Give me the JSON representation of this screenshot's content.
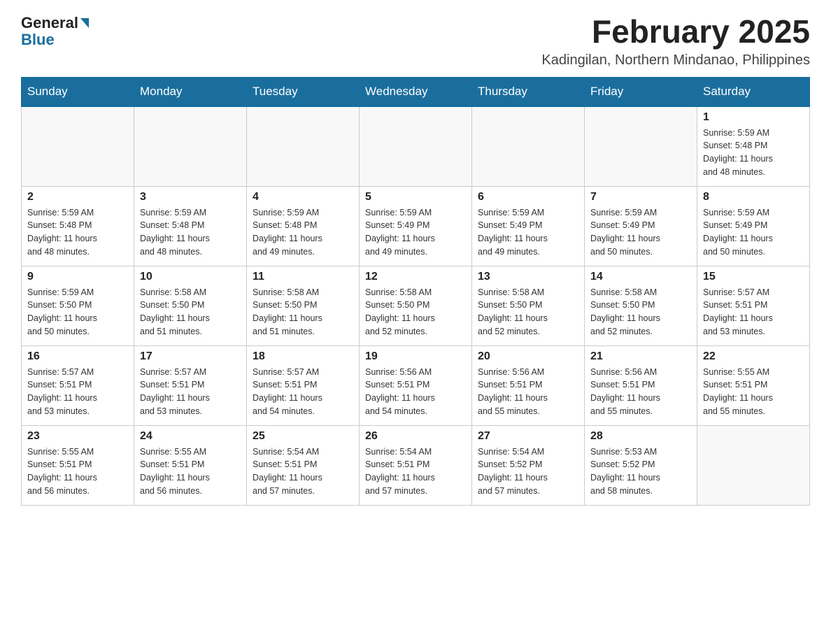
{
  "header": {
    "logo_general": "General",
    "logo_blue": "Blue",
    "title": "February 2025",
    "subtitle": "Kadingilan, Northern Mindanao, Philippines"
  },
  "days_of_week": [
    "Sunday",
    "Monday",
    "Tuesday",
    "Wednesday",
    "Thursday",
    "Friday",
    "Saturday"
  ],
  "weeks": [
    [
      {
        "day": "",
        "info": ""
      },
      {
        "day": "",
        "info": ""
      },
      {
        "day": "",
        "info": ""
      },
      {
        "day": "",
        "info": ""
      },
      {
        "day": "",
        "info": ""
      },
      {
        "day": "",
        "info": ""
      },
      {
        "day": "1",
        "info": "Sunrise: 5:59 AM\nSunset: 5:48 PM\nDaylight: 11 hours\nand 48 minutes."
      }
    ],
    [
      {
        "day": "2",
        "info": "Sunrise: 5:59 AM\nSunset: 5:48 PM\nDaylight: 11 hours\nand 48 minutes."
      },
      {
        "day": "3",
        "info": "Sunrise: 5:59 AM\nSunset: 5:48 PM\nDaylight: 11 hours\nand 48 minutes."
      },
      {
        "day": "4",
        "info": "Sunrise: 5:59 AM\nSunset: 5:48 PM\nDaylight: 11 hours\nand 49 minutes."
      },
      {
        "day": "5",
        "info": "Sunrise: 5:59 AM\nSunset: 5:49 PM\nDaylight: 11 hours\nand 49 minutes."
      },
      {
        "day": "6",
        "info": "Sunrise: 5:59 AM\nSunset: 5:49 PM\nDaylight: 11 hours\nand 49 minutes."
      },
      {
        "day": "7",
        "info": "Sunrise: 5:59 AM\nSunset: 5:49 PM\nDaylight: 11 hours\nand 50 minutes."
      },
      {
        "day": "8",
        "info": "Sunrise: 5:59 AM\nSunset: 5:49 PM\nDaylight: 11 hours\nand 50 minutes."
      }
    ],
    [
      {
        "day": "9",
        "info": "Sunrise: 5:59 AM\nSunset: 5:50 PM\nDaylight: 11 hours\nand 50 minutes."
      },
      {
        "day": "10",
        "info": "Sunrise: 5:58 AM\nSunset: 5:50 PM\nDaylight: 11 hours\nand 51 minutes."
      },
      {
        "day": "11",
        "info": "Sunrise: 5:58 AM\nSunset: 5:50 PM\nDaylight: 11 hours\nand 51 minutes."
      },
      {
        "day": "12",
        "info": "Sunrise: 5:58 AM\nSunset: 5:50 PM\nDaylight: 11 hours\nand 52 minutes."
      },
      {
        "day": "13",
        "info": "Sunrise: 5:58 AM\nSunset: 5:50 PM\nDaylight: 11 hours\nand 52 minutes."
      },
      {
        "day": "14",
        "info": "Sunrise: 5:58 AM\nSunset: 5:50 PM\nDaylight: 11 hours\nand 52 minutes."
      },
      {
        "day": "15",
        "info": "Sunrise: 5:57 AM\nSunset: 5:51 PM\nDaylight: 11 hours\nand 53 minutes."
      }
    ],
    [
      {
        "day": "16",
        "info": "Sunrise: 5:57 AM\nSunset: 5:51 PM\nDaylight: 11 hours\nand 53 minutes."
      },
      {
        "day": "17",
        "info": "Sunrise: 5:57 AM\nSunset: 5:51 PM\nDaylight: 11 hours\nand 53 minutes."
      },
      {
        "day": "18",
        "info": "Sunrise: 5:57 AM\nSunset: 5:51 PM\nDaylight: 11 hours\nand 54 minutes."
      },
      {
        "day": "19",
        "info": "Sunrise: 5:56 AM\nSunset: 5:51 PM\nDaylight: 11 hours\nand 54 minutes."
      },
      {
        "day": "20",
        "info": "Sunrise: 5:56 AM\nSunset: 5:51 PM\nDaylight: 11 hours\nand 55 minutes."
      },
      {
        "day": "21",
        "info": "Sunrise: 5:56 AM\nSunset: 5:51 PM\nDaylight: 11 hours\nand 55 minutes."
      },
      {
        "day": "22",
        "info": "Sunrise: 5:55 AM\nSunset: 5:51 PM\nDaylight: 11 hours\nand 55 minutes."
      }
    ],
    [
      {
        "day": "23",
        "info": "Sunrise: 5:55 AM\nSunset: 5:51 PM\nDaylight: 11 hours\nand 56 minutes."
      },
      {
        "day": "24",
        "info": "Sunrise: 5:55 AM\nSunset: 5:51 PM\nDaylight: 11 hours\nand 56 minutes."
      },
      {
        "day": "25",
        "info": "Sunrise: 5:54 AM\nSunset: 5:51 PM\nDaylight: 11 hours\nand 57 minutes."
      },
      {
        "day": "26",
        "info": "Sunrise: 5:54 AM\nSunset: 5:51 PM\nDaylight: 11 hours\nand 57 minutes."
      },
      {
        "day": "27",
        "info": "Sunrise: 5:54 AM\nSunset: 5:52 PM\nDaylight: 11 hours\nand 57 minutes."
      },
      {
        "day": "28",
        "info": "Sunrise: 5:53 AM\nSunset: 5:52 PM\nDaylight: 11 hours\nand 58 minutes."
      },
      {
        "day": "",
        "info": ""
      }
    ]
  ]
}
